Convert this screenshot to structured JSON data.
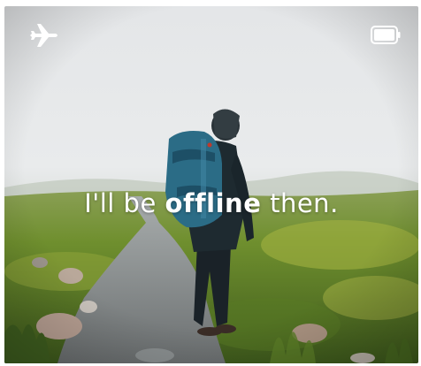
{
  "status_bar": {
    "left_icon": "airplane-mode-icon",
    "right_icon": "battery-icon"
  },
  "headline": {
    "prefix": "I'll be",
    "emphasis": "offline",
    "suffix": "then."
  },
  "colors": {
    "sky": "#e9ebec",
    "fog": "#d7dcd8",
    "grass": "#6f8f2e",
    "moss": "#9aa83c",
    "path": "#8e9495",
    "jacket": "#1e2a30",
    "backpack": "#2b6c86",
    "text": "#ffffff"
  }
}
